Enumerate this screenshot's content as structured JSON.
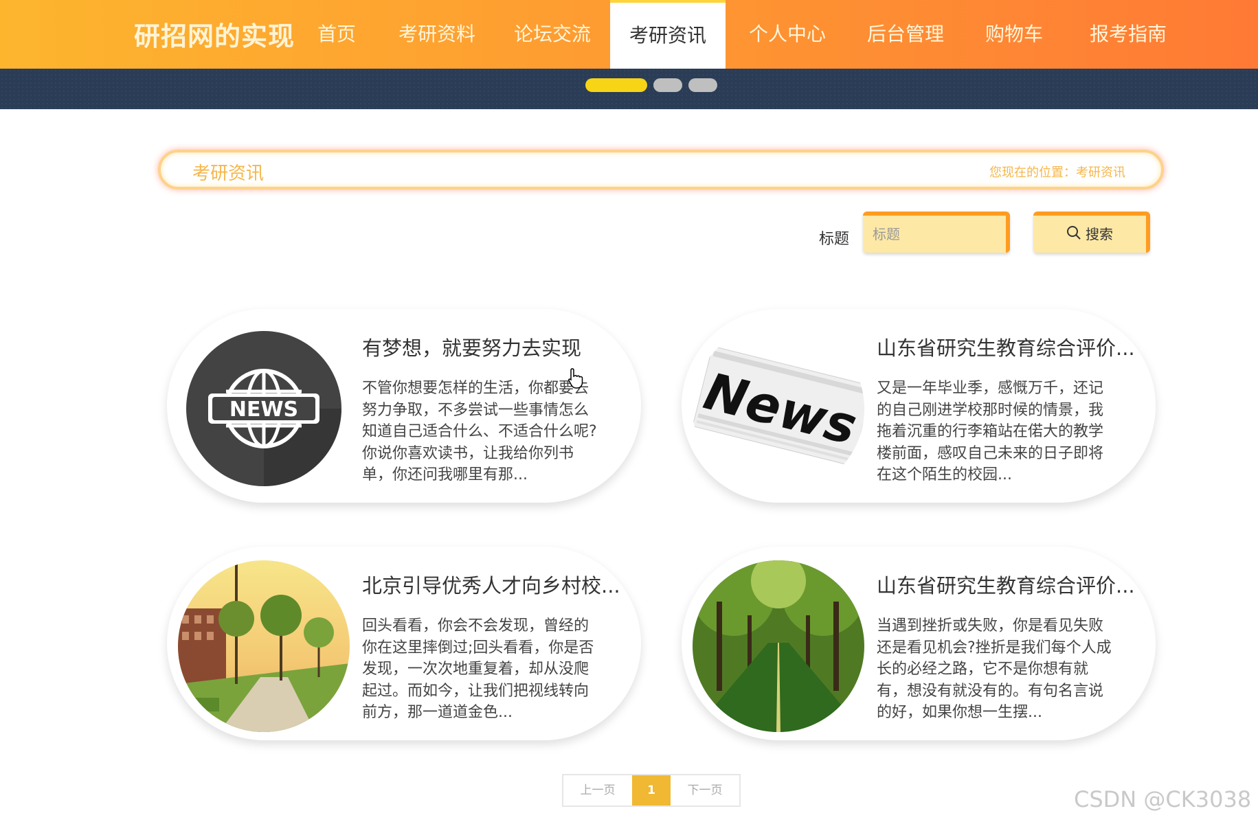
{
  "nav": {
    "logo": "研招网的实现",
    "items": [
      {
        "label": "首页"
      },
      {
        "label": "考研资料"
      },
      {
        "label": "论坛交流"
      },
      {
        "label": "考研资讯",
        "active": true
      },
      {
        "label": "个人中心"
      },
      {
        "label": "后台管理"
      },
      {
        "label": "购物车"
      },
      {
        "label": "报考指南"
      }
    ],
    "gradient": [
      "#fdb52e",
      "#ff7a35"
    ]
  },
  "banner": {
    "dots": [
      {
        "state": "active",
        "color": "#f7d416"
      },
      {
        "state": "inactive",
        "color": "#bfbfbf"
      },
      {
        "state": "inactive",
        "color": "#bfbfbf"
      }
    ]
  },
  "section": {
    "title": "考研资讯",
    "location_label": "您现在的位置：",
    "location_value": "考研资讯"
  },
  "search": {
    "label": "标题",
    "placeholder": "标题",
    "button_label": "搜索",
    "button_icon": "search-icon"
  },
  "news": [
    {
      "title": "有梦想，就要努力去实现",
      "summary": "不管你想要怎样的生活，你都要去努力争取，不多尝试一些事情怎么知道自己适合什么、不适合什么呢?你说你喜欢读书，让我给你列书单，你还问我哪里有那...",
      "image": "news-globe-image"
    },
    {
      "title": "山东省研究生教育综合评价...",
      "summary": "又是一年毕业季，感慨万千，还记的自己刚进学校那时候的情景，我拖着沉重的行李箱站在偌大的教学楼前面，感叹自己未来的日子即将在这个陌生的校园...",
      "image": "newspaper-image"
    },
    {
      "title": "北京引导优秀人才向乡村校...",
      "summary": "回头看看，你会不会发现，曾经的你在这里摔倒过;回头看看，你是否发现，一次次地重复着，却从没爬起过。而如今，让我们把视线转向前方，那一道道金色...",
      "image": "campus-trees-image"
    },
    {
      "title": "山东省研究生教育综合评价...",
      "summary": "当遇到挫折或失败，你是看见失败还是看见机会?挫折是我们每个人成长的必经之路，它不是你想有就有，想没有就没有的。有句名言说的好，如果你想一生摆...",
      "image": "forest-road-image"
    }
  ],
  "pager": {
    "prev": "上一页",
    "current": "1",
    "next": "下一页"
  },
  "watermark": "CSDN @CK3038",
  "colors": {
    "accent": "#ff9c1f",
    "input_bg": "#fde8a6",
    "title_text": "#f5b64a",
    "pager_active": "#f0b833"
  }
}
